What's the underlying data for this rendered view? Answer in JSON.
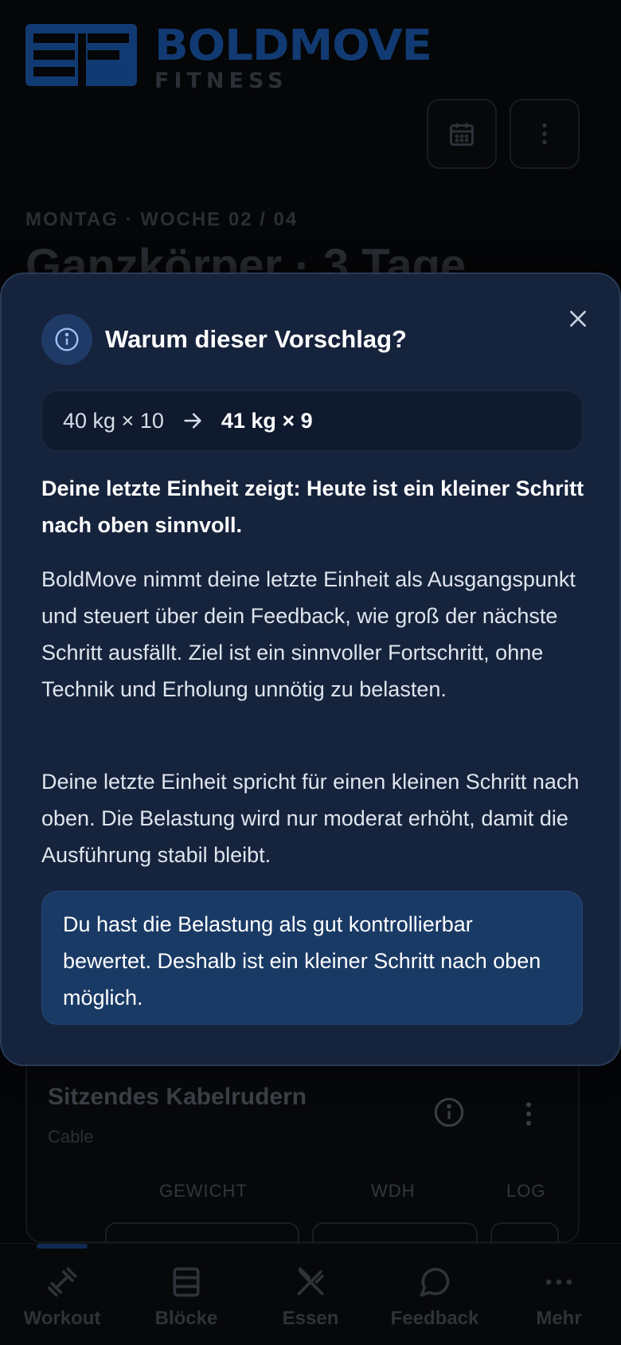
{
  "brand": {
    "name": "BOLDMOVE",
    "subtitle": "FITNESS",
    "mark_text": "BF"
  },
  "header": {
    "day_line": "MONTAG · WOCHE 02 / 04",
    "plan_title": "Ganzkörper · 3 Tage",
    "calendar_icon": "calendar-icon",
    "more_icon": "more-vertical-icon"
  },
  "exercise": {
    "name": "Sitzendes Kabelrudern",
    "equipment": "Cable",
    "columns": [
      "GEWICHT",
      "WDH",
      "LOG"
    ]
  },
  "modal": {
    "title": "Warum dieser Vorschlag?",
    "from": "40 kg × 10",
    "to": "41 kg × 9",
    "lead": "Deine letzte Einheit zeigt: Heute ist ein kleiner Schritt nach oben sinnvoll.",
    "paragraph1": "BoldMove nimmt deine letzte Einheit als Ausgangspunkt und steuert über dein Feedback, wie groß der nächste Schritt ausfällt. Ziel ist ein sinnvoller Fortschritt, ohne Technik und Erholung unnötig zu belasten.",
    "paragraph2": "Deine letzte Einheit spricht für einen kleinen Schritt nach oben. Die Belastung wird nur moderat erhöht, damit die Ausführung stabil bleibt.",
    "note": "Du hast die Belastung als gut kontrollierbar bewertet. Deshalb ist ein kleiner Schritt nach oben möglich."
  },
  "nav": {
    "items": [
      {
        "label": "Workout",
        "icon": "dumbbell-icon"
      },
      {
        "label": "Blöcke",
        "icon": "blocks-icon"
      },
      {
        "label": "Essen",
        "icon": "utensils-icon"
      },
      {
        "label": "Feedback",
        "icon": "chat-icon"
      },
      {
        "label": "Mehr",
        "icon": "more-horizontal-icon"
      }
    ],
    "active_index": 0
  },
  "colors": {
    "sheet_bg": "#16233c",
    "note_bg": "#1a3a66",
    "brand_blue": "#123a72"
  }
}
